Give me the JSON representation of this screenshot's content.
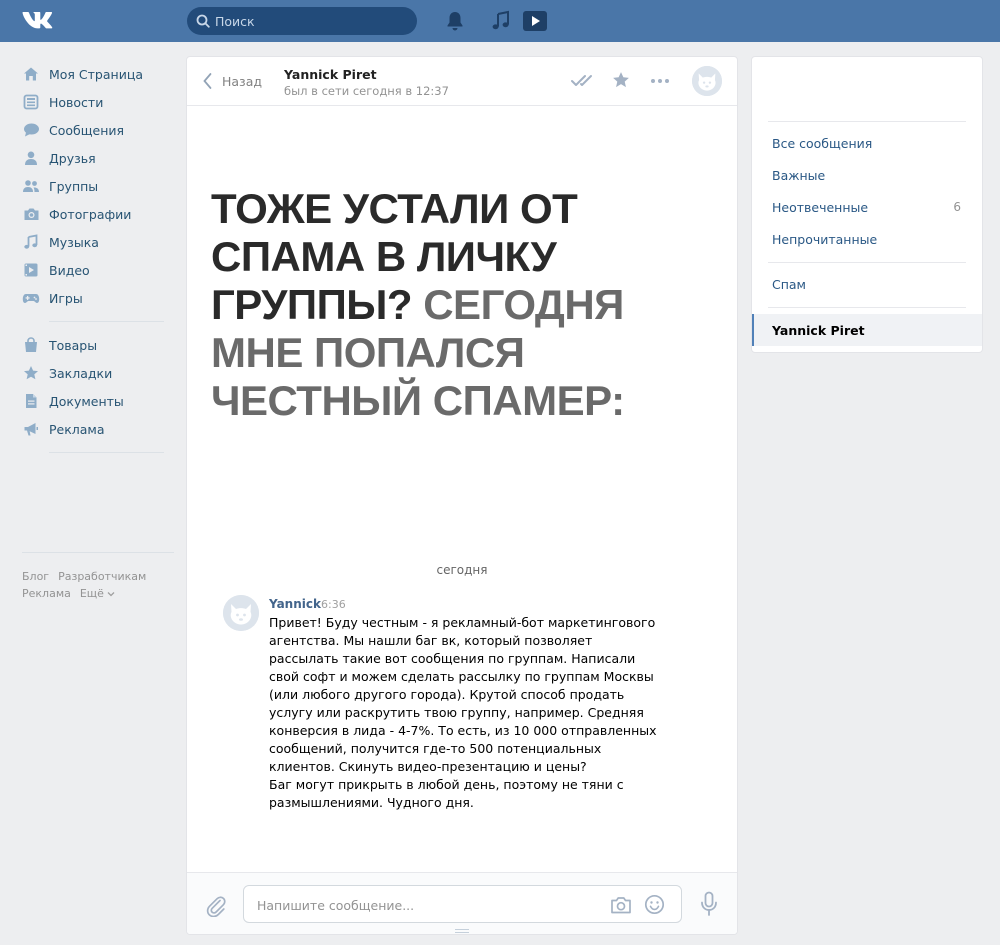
{
  "topbar": {
    "search_placeholder": "Поиск",
    "icons": [
      "vk-logo-icon",
      "search-icon",
      "bell-icon",
      "music-note-icon",
      "video-play-icon"
    ]
  },
  "sidebar": {
    "items": [
      {
        "label": "Моя Страница",
        "icon": "home-icon"
      },
      {
        "label": "Новости",
        "icon": "news-icon"
      },
      {
        "label": "Сообщения",
        "icon": "chat-bubble-icon"
      },
      {
        "label": "Друзья",
        "icon": "person-icon"
      },
      {
        "label": "Группы",
        "icon": "people-icon"
      },
      {
        "label": "Фотографии",
        "icon": "camera-icon"
      },
      {
        "label": "Музыка",
        "icon": "music-note-icon"
      },
      {
        "label": "Видео",
        "icon": "film-icon"
      },
      {
        "label": "Игры",
        "icon": "gamepad-icon"
      }
    ],
    "items2": [
      {
        "label": "Товары",
        "icon": "shopping-bag-icon"
      },
      {
        "label": "Закладки",
        "icon": "star-icon"
      },
      {
        "label": "Документы",
        "icon": "document-icon"
      },
      {
        "label": "Реклама",
        "icon": "megaphone-icon"
      }
    ],
    "footer": {
      "blog": "Блог",
      "developers": "Разработчикам",
      "ads": "Реклама",
      "more": "Ещё"
    }
  },
  "chat": {
    "back_label": "Назад",
    "peer_name": "Yannick Piret",
    "peer_status": "был в сети сегодня в 12:37",
    "overlay": {
      "dark": "ТОЖЕ УСТАЛИ ОТ СПАМА В ЛИЧКУ ГРУППЫ?",
      "grey": "СЕГОДНЯ МНЕ ПОПАЛСЯ ЧЕСТНЫЙ СПАМЕР:"
    },
    "day_label": "сегодня",
    "message": {
      "author": "Yannick",
      "time": "6:36",
      "paragraph1": "Привет! Буду честным - я рекламный-бот маркетингового агентства. Мы нашли баг вк, который позволяет рассылать такие вот сообщения по группам. Написали свой софт и можем сделать рассылку по группам Москвы (или любого другого города). Крутой способ продать услугу или раскрутить твою группу, например. Средняя конверсия в лида - 4-7%. То есть, из 10 000 отправленных сообщений, получится где-то 500 потенциальных клиентов. Скинуть видео-презентацию и цены?",
      "paragraph2": "Баг могут прикрыть в любой день, поэтому не тяни с размышлениями. Чудного дня."
    },
    "compose_placeholder": "Напишите сообщение..."
  },
  "filters": {
    "items": [
      {
        "label": "Все сообщения",
        "count": ""
      },
      {
        "label": "Важные",
        "count": ""
      },
      {
        "label": "Неотвеченные",
        "count": "6"
      },
      {
        "label": "Непрочитанные",
        "count": ""
      }
    ],
    "spam": "Спам",
    "active_conversation": "Yannick Piret"
  },
  "colors": {
    "header_blue": "#4a76a8",
    "link_blue": "#2a5885",
    "background": "#edeef0"
  }
}
